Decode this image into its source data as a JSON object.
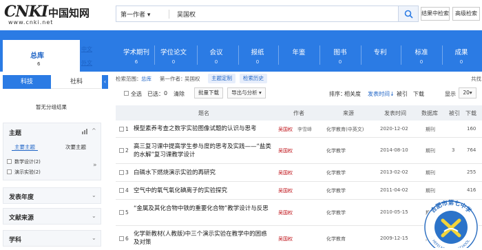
{
  "logo": {
    "mark": "CNKI",
    "cn": "中国知网",
    "url": "www.cnki.net"
  },
  "search": {
    "field": "第一作者",
    "value": "吴国权"
  },
  "buttons": {
    "in_results": "结果中检索",
    "advanced": "高级检索"
  },
  "library": {
    "title": "总库",
    "count": "6",
    "zh": "中文",
    "en": "外文"
  },
  "categories": [
    {
      "label": "学术期刊",
      "count": "6"
    },
    {
      "label": "学位论文",
      "count": "0"
    },
    {
      "label": "会议",
      "count": "0"
    },
    {
      "label": "报纸",
      "count": "0"
    },
    {
      "label": "年鉴",
      "count": ""
    },
    {
      "label": "图书",
      "count": "0"
    },
    {
      "label": "专利",
      "count": ""
    },
    {
      "label": "标准",
      "count": "0"
    },
    {
      "label": "成果",
      "count": "0"
    }
  ],
  "side_tabs": {
    "tech": "科技",
    "social": "社科"
  },
  "no_results": "暂无分组结果",
  "facets": {
    "topic": "主题",
    "major": "主要主题",
    "minor": "次要主题",
    "items": [
      {
        "label": "数学设计(2)"
      },
      {
        "label": "演示实验(2)"
      }
    ],
    "year": "发表年度",
    "source": "文献来源",
    "subject": "学科"
  },
  "crumb": {
    "range_label": "检索范围：",
    "range_value": "总库",
    "cond_label": "第一作者：",
    "cond_value": "吴国权",
    "custom": "主题定制",
    "history": "检索历史",
    "share": "共找"
  },
  "toolbar": {
    "select_all": "全选",
    "selected": "已选：",
    "selected_count": "0",
    "clear": "清除",
    "batch": "批量下载",
    "export": "导出与分析",
    "sort_label": "排序：",
    "sort_rel": "相关度",
    "sort_date": "发表时间",
    "sort_cite": "被引",
    "sort_dl": "下载",
    "show_label": "显示",
    "show_count": "20"
  },
  "columns": {
    "title": "题名",
    "author": "作者",
    "source": "来源",
    "date": "发表时间",
    "db": "数据库",
    "cite": "被引",
    "download": "下载"
  },
  "rows": [
    {
      "num": "1",
      "title": "模型素养考查之数字实验图像试题的认识与思考",
      "author": "吴国权",
      "coauthor": "李雪峰",
      "source": "化学教育(中英文)",
      "date": "2020-12-02",
      "db": "期刊",
      "cite": "",
      "dl": "160"
    },
    {
      "num": "2",
      "title": "高三复习课中提高学生参与度的思考及实践——“盐类的水解”复习课教学设计",
      "author": "吴国权",
      "coauthor": "",
      "source": "化学教学",
      "date": "2014-08-10",
      "db": "期刊",
      "cite": "3",
      "dl": "764"
    },
    {
      "num": "3",
      "title": "白磷水下燃烧演示实验的再研究",
      "author": "吴国权",
      "coauthor": "",
      "source": "化学教学",
      "date": "2013-02-02",
      "db": "期刊",
      "cite": "",
      "dl": "255"
    },
    {
      "num": "4",
      "title": "空气中的氧气氧化碘离子的实验探究",
      "author": "吴国权",
      "coauthor": "",
      "source": "化学教学",
      "date": "2011-04-02",
      "db": "期刊",
      "cite": "",
      "dl": "416"
    },
    {
      "num": "5",
      "title": "“金属及其化合物中铁的重要化合物”教学设计与反思",
      "author": "吴国权",
      "coauthor": "",
      "source": "化学教学",
      "date": "2010-05-15",
      "db": "期刊",
      "cite": "",
      "dl": ""
    },
    {
      "num": "6",
      "title": "化学新教材(人教版)中三个演示实验在教学中的困惑及对策",
      "author": "吴国权",
      "coauthor": "",
      "source": "化学教育",
      "date": "2009-12-15",
      "db": "期刊",
      "cite": "",
      "dl": ""
    }
  ],
  "seal": {
    "top": "合肥市第七中学",
    "bottom": "HEFEI NO.7 HIGH SCHOOL"
  },
  "colors": {
    "brand_blue": "#2b7be4",
    "author_red": "#c0141b"
  }
}
